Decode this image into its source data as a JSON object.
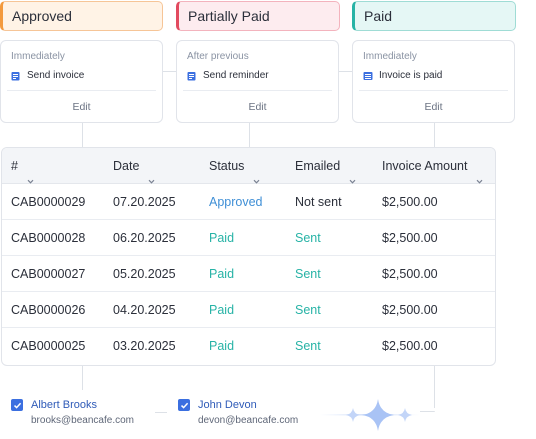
{
  "statuses": {
    "approved": "Approved",
    "partially_paid": "Partially Paid",
    "paid": "Paid"
  },
  "rules": [
    {
      "timing": "Immediately",
      "action": "Send invoice",
      "edit": "Edit",
      "icon": "document-icon"
    },
    {
      "timing": "After previous",
      "action": "Send reminder",
      "edit": "Edit",
      "icon": "document-icon"
    },
    {
      "timing": "Immediately",
      "action": "Invoice is paid",
      "edit": "Edit",
      "icon": "list-icon"
    }
  ],
  "table": {
    "columns": [
      "#",
      "Date",
      "Status",
      "Emailed",
      "Invoice Amount"
    ],
    "rows": [
      {
        "id": "CAB0000029",
        "date": "07.20.2025",
        "status": "Approved",
        "emailed": "Not sent",
        "amount": "$2,500.00"
      },
      {
        "id": "CAB0000028",
        "date": "06.20.2025",
        "status": "Paid",
        "emailed": "Sent",
        "amount": "$2,500.00"
      },
      {
        "id": "CAB0000027",
        "date": "05.20.2025",
        "status": "Paid",
        "emailed": "Sent",
        "amount": "$2,500.00"
      },
      {
        "id": "CAB0000026",
        "date": "04.20.2025",
        "status": "Paid",
        "emailed": "Sent",
        "amount": "$2,500.00"
      },
      {
        "id": "CAB0000025",
        "date": "03.20.2025",
        "status": "Paid",
        "emailed": "Sent",
        "amount": "$2,500.00"
      }
    ]
  },
  "recipients": [
    {
      "name": "Albert Brooks",
      "email": "brooks@beancafe.com",
      "checked": true
    },
    {
      "name": "John Devon",
      "email": "devon@beancafe.com",
      "checked": true
    }
  ],
  "colors": {
    "approved_accent": "#f39a3e",
    "partial_accent": "#e24a5f",
    "paid_accent": "#27b3a6",
    "link_blue": "#3f8fd6",
    "checkbox_blue": "#3b6fe0",
    "sparkle": "#a9c3f5"
  }
}
